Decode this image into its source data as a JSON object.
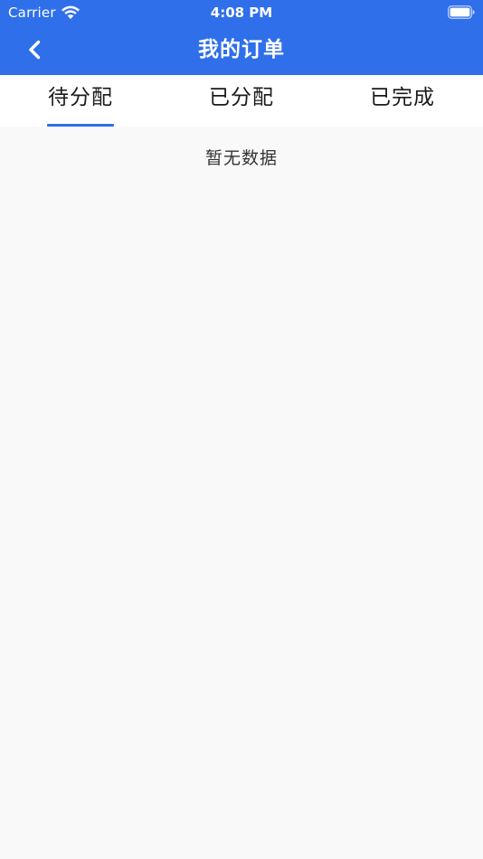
{
  "status_bar": {
    "carrier": "Carrier",
    "time": "4:08 PM",
    "wifi_icon": "wifi-icon",
    "battery_icon": "battery-icon"
  },
  "nav": {
    "title": "我的订单",
    "back_icon": "chevron-left-icon"
  },
  "tabs": [
    {
      "label": "待分配",
      "selected": true
    },
    {
      "label": "已分配",
      "selected": false
    },
    {
      "label": "已完成",
      "selected": false
    }
  ],
  "content": {
    "empty_text": "暂无数据"
  },
  "colors": {
    "accent": "#2f6fea",
    "background": "#f9f9f9",
    "tab_background": "#ffffff",
    "text": "#1a1a1a"
  }
}
